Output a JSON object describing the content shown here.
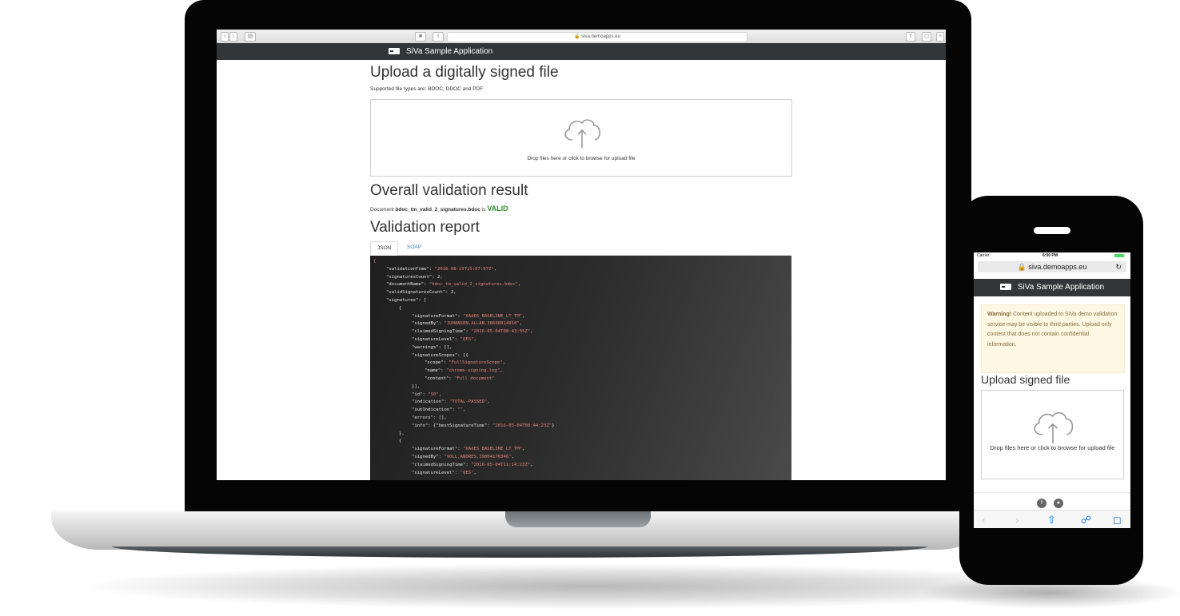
{
  "laptop": {
    "browser": {
      "url": "siva.demoapps.eu"
    },
    "app": {
      "title": "SiVa Sample Application",
      "upload_heading": "Upload a digitally signed file",
      "supported_types": "Supported file types are: BDOC, DDOC and PDF",
      "drop_text": "Drop files here or click to browse for upload file",
      "result_heading": "Overall validation result",
      "result_prefix": "Document",
      "result_filename": "bdoc_tm_valid_2_signatures.bdoc",
      "result_is": "is",
      "result_status": "VALID",
      "report_heading": "Validation report",
      "tabs": [
        {
          "label": "JSON",
          "active": true
        },
        {
          "label": "SOAP",
          "active": false
        }
      ],
      "json_lines": [
        {
          "indent": 0,
          "key": "",
          "value": "{",
          "tail": ""
        },
        {
          "indent": 1,
          "key": "\"validationTime\": ",
          "value": "\"2016-08-19T15:07:07Z\"",
          "tail": ","
        },
        {
          "indent": 1,
          "key": "\"signaturesCount\": 2,",
          "value": "",
          "tail": ""
        },
        {
          "indent": 1,
          "key": "\"documentName\": ",
          "value": "\"bdoc_tm_valid_2_signatures.bdoc\"",
          "tail": ","
        },
        {
          "indent": 1,
          "key": "\"validSignaturesCount\": 2,",
          "value": "",
          "tail": ""
        },
        {
          "indent": 1,
          "key": "\"signatures\": [",
          "value": "",
          "tail": ""
        },
        {
          "indent": 2,
          "key": "{",
          "value": "",
          "tail": ""
        },
        {
          "indent": 3,
          "key": "\"signatureFormat\": ",
          "value": "\"XAdES_BASELINE_LT_TM\"",
          "tail": ","
        },
        {
          "indent": 3,
          "key": "\"signedBy\": ",
          "value": "\"JUHANSON,ALLAN,38608014910\"",
          "tail": ","
        },
        {
          "indent": 3,
          "key": "\"claimedSigningTime\": ",
          "value": "\"2016-05-04T08:43:55Z\"",
          "tail": ","
        },
        {
          "indent": 3,
          "key": "\"signatureLevel\": ",
          "value": "\"QES\"",
          "tail": ","
        },
        {
          "indent": 3,
          "key": "\"warnings\": [],",
          "value": "",
          "tail": ""
        },
        {
          "indent": 3,
          "key": "\"signatureScopes\": [{",
          "value": "",
          "tail": ""
        },
        {
          "indent": 4,
          "key": "\"scope\": ",
          "value": "\"FullSignatureScope\"",
          "tail": ","
        },
        {
          "indent": 4,
          "key": "\"name\": ",
          "value": "\"chrome-signing.log\"",
          "tail": ","
        },
        {
          "indent": 4,
          "key": "\"content\": ",
          "value": "\"Full document\"",
          "tail": ""
        },
        {
          "indent": 3,
          "key": "}],",
          "value": "",
          "tail": ""
        },
        {
          "indent": 3,
          "key": "\"id\": ",
          "value": "\"S0\"",
          "tail": ","
        },
        {
          "indent": 3,
          "key": "\"indication\": ",
          "value": "\"TOTAL-PASSED\"",
          "tail": ","
        },
        {
          "indent": 3,
          "key": "\"subIndication\": ",
          "value": "\"\"",
          "tail": ","
        },
        {
          "indent": 3,
          "key": "\"errors\": [],",
          "value": "",
          "tail": ""
        },
        {
          "indent": 3,
          "key": "\"info\": {\"bestSignatureTime\": ",
          "value": "\"2016-05-04T08:44:23Z\"",
          "tail": "}"
        },
        {
          "indent": 2,
          "key": "},",
          "value": "",
          "tail": ""
        },
        {
          "indent": 2,
          "key": "{",
          "value": "",
          "tail": ""
        },
        {
          "indent": 3,
          "key": "\"signatureFormat\": ",
          "value": "\"XAdES_BASELINE_LT_TM\"",
          "tail": ","
        },
        {
          "indent": 3,
          "key": "\"signedBy\": ",
          "value": "\"VOLL,ANDRES,39004170346\"",
          "tail": ","
        },
        {
          "indent": 3,
          "key": "\"claimedSigningTime\": ",
          "value": "\"2016-05-04T11:14:23Z\"",
          "tail": ","
        },
        {
          "indent": 3,
          "key": "\"signatureLevel\": ",
          "value": "\"QES\"",
          "tail": ","
        }
      ]
    }
  },
  "phone": {
    "status": {
      "carrier": "Carrier",
      "time": "6:00 PM"
    },
    "url": "siva.demoapps.eu",
    "title": "SiVa Sample Application",
    "warning_bold": "Warning!",
    "warning_text": "Content uploaded to SiVa demo validation service may be visible to third parties. Upload only content that does not contain confidential information.",
    "upload_heading": "Upload signed file",
    "drop_text": "Drop files here or click to browse for upload file"
  },
  "colors": {
    "navbar": "#333638",
    "valid": "#2e8b2e",
    "json_string": "#e8867a",
    "link": "#337ab7"
  }
}
